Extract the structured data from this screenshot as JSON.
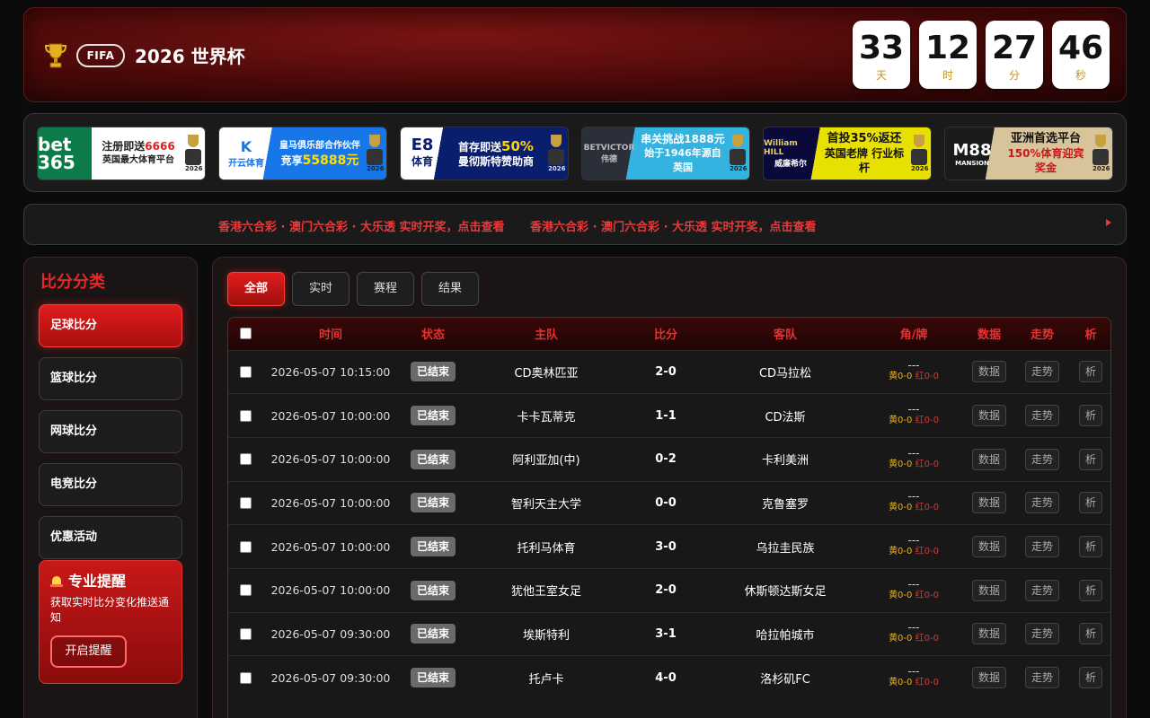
{
  "header": {
    "fifa_badge": "FIFA",
    "title": "2026 世界杯",
    "countdown": [
      {
        "value": "33",
        "unit": "天"
      },
      {
        "value": "12",
        "unit": "时"
      },
      {
        "value": "27",
        "unit": "分"
      },
      {
        "value": "46",
        "unit": "秒"
      }
    ]
  },
  "banners": [
    {
      "logo": "bet 365",
      "line1_a": "注册即送",
      "line1_b": "6666",
      "line2": "英国最大体育平台",
      "year": "2026"
    },
    {
      "logo": "开云体育",
      "line1": "皇马俱乐部合作伙伴",
      "line2_a": "竞享",
      "line2_b": "55888元",
      "year": "2026"
    },
    {
      "logo_a": "E8",
      "logo_b": "体育",
      "line1_a": "首存即送",
      "line1_b": "50%",
      "line2": "曼彻斯特赞助商",
      "year": "2026"
    },
    {
      "logo_a": "BETVICTOR",
      "logo_b": "伟德",
      "line1": "串关挑战1888元",
      "line2": "始于1946年源自英国",
      "year": "2026"
    },
    {
      "logo_a": "William HILL",
      "logo_b": "威廉希尔",
      "line1": "首投35%返还",
      "line2": "英国老牌 行业标杆",
      "year": "2026"
    },
    {
      "logo_a": "M88",
      "logo_b": "MANSION",
      "line1": "亚洲首选平台",
      "line2_a": "150%",
      "line2_b": "体育迎宾奖金",
      "year": "2026"
    }
  ],
  "ticker": {
    "items": [
      "香港六合彩 · 澳门六合彩 · 大乐透 实时开奖，点击查看",
      "香港六合彩 · 澳门六合彩 · 大乐透 实时开奖，点击查看"
    ]
  },
  "sidebar": {
    "title": "比分分类",
    "items": [
      {
        "label": "足球比分",
        "active": true
      },
      {
        "label": "篮球比分",
        "active": false
      },
      {
        "label": "网球比分",
        "active": false
      },
      {
        "label": "电竞比分",
        "active": false
      },
      {
        "label": "优惠活动",
        "active": false
      }
    ],
    "alert": {
      "title": "专业提醒",
      "desc": "获取实时比分变化推送通知",
      "button": "开启提醒"
    }
  },
  "main": {
    "tabs": [
      {
        "label": "全部",
        "active": true
      },
      {
        "label": "实时",
        "active": false
      },
      {
        "label": "赛程",
        "active": false
      },
      {
        "label": "结果",
        "active": false
      }
    ],
    "columns": [
      "时间",
      "状态",
      "主队",
      "比分",
      "客队",
      "角/牌",
      "数据",
      "走势",
      "析"
    ],
    "row_labels": {
      "corner_dash": "---",
      "yellow": "黄0-0",
      "red": "红0-0",
      "data": "数据",
      "trend": "走势",
      "analysis": "析"
    },
    "rows": [
      {
        "time": "2026-05-07 10:15:00",
        "status": "已结束",
        "home": "CD奥林匹亚",
        "score": "2-0",
        "away": "CD马拉松"
      },
      {
        "time": "2026-05-07 10:00:00",
        "status": "已结束",
        "home": "卡卡瓦蒂克",
        "score": "1-1",
        "away": "CD法斯"
      },
      {
        "time": "2026-05-07 10:00:00",
        "status": "已结束",
        "home": "阿利亚加(中)",
        "score": "0-2",
        "away": "卡利美洲"
      },
      {
        "time": "2026-05-07 10:00:00",
        "status": "已结束",
        "home": "智利天主大学",
        "score": "0-0",
        "away": "克鲁塞罗"
      },
      {
        "time": "2026-05-07 10:00:00",
        "status": "已结束",
        "home": "托利马体育",
        "score": "3-0",
        "away": "乌拉圭民族"
      },
      {
        "time": "2026-05-07 10:00:00",
        "status": "已结束",
        "home": "犹他王室女足",
        "score": "2-0",
        "away": "休斯顿达斯女足"
      },
      {
        "time": "2026-05-07 09:30:00",
        "status": "已结束",
        "home": "埃斯特利",
        "score": "3-1",
        "away": "哈拉帕城市"
      },
      {
        "time": "2026-05-07 09:30:00",
        "status": "已结束",
        "home": "托卢卡",
        "score": "4-0",
        "away": "洛杉矶FC"
      }
    ]
  }
}
